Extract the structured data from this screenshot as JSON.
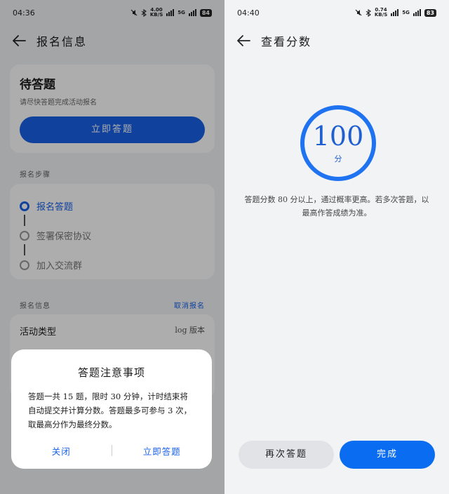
{
  "left": {
    "status": {
      "time": "04:36",
      "speed": "4.00",
      "speed_unit": "KB/S",
      "network": "5G",
      "battery": "84"
    },
    "header": {
      "title": "报名信息"
    },
    "pending": {
      "title": "待答题",
      "subtitle": "请尽快答题完成活动报名",
      "button": "立即答题"
    },
    "steps_label": "报名步骤",
    "steps": [
      {
        "label": "报名答题"
      },
      {
        "label": "签署保密协议"
      },
      {
        "label": "加入交流群"
      }
    ],
    "info_label": "报名信息",
    "cancel_label": "取消报名",
    "info_rows": [
      {
        "key": "活动类型",
        "value": "log 版本"
      }
    ],
    "dialog": {
      "title": "答题注意事项",
      "body": "答题一共 15 题，限时 30 分钟，计时结束将自动提交并计算分数。答题最多可参与 3 次，取最高分作为最终分数。",
      "close": "关闭",
      "confirm": "立即答题"
    }
  },
  "right": {
    "status": {
      "time": "04:40",
      "speed": "0.74",
      "speed_unit": "KB/S",
      "network": "5G",
      "battery": "83"
    },
    "header": {
      "title": "查看分数"
    },
    "score": {
      "value": "100",
      "unit": "分"
    },
    "note": "答题分数 80 分以上，通过概率更高。若多次答题，以最高作答成绩为准。",
    "retry_button": "再次答题",
    "done_button": "完成"
  },
  "colors": {
    "primary": "#1760e8",
    "ring": "#1f73f0",
    "background": "#f1f3f5"
  },
  "icons": [
    "back-arrow-icon",
    "bluetooth-icon",
    "mute-icon",
    "signal-icon",
    "battery-icon"
  ]
}
